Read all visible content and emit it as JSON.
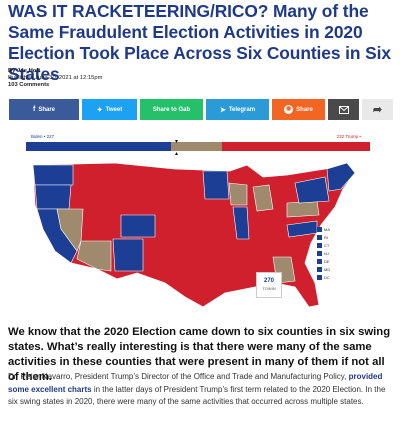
{
  "article": {
    "headline": "WAS IT RACKETEERING/RICO? Many of the Same Fraudulent Election Activities in 2020 Election Took Place Across Six Counties in Six States",
    "author": "By Joe Hoft",
    "published": "Published June 30, 2021 at 12:15pm",
    "comments": "103 Comments"
  },
  "share": {
    "facebook": "Share",
    "twitter": "Tweet",
    "gab": "Share to Gab",
    "telegram": "Telegram",
    "share": "Share"
  },
  "map": {
    "biden_label": "Biden • 227",
    "trump_label": "232  Trump •",
    "badge_number": "270",
    "badge_text": "TOWIN",
    "biden_ev": 227,
    "trump_ev": 232,
    "colors": {
      "biden": "#1c3f95",
      "trump": "#d0202e",
      "tossup": "#a08a6e"
    },
    "east_states": [
      "MA",
      "RI",
      "CT",
      "NJ",
      "DE",
      "MD",
      "DC"
    ]
  },
  "body": {
    "lead": "We know that the 2020 Election came down to six counties in six swing states. What’s really interesting is that there were many of the same activities in these counties that were present in many of them if not all of them.",
    "para_start": "Dr. Peter Navarro, President Trump’s Director of the Office and Trade and Manufacturing Policy, ",
    "para_link": "provided some excellent charts",
    "para_end": " in the latter days of President Trump’s first term related to the 2020 Election.  In the six swing states in 2020, there were many of the same activities that occurred across multiple states."
  }
}
